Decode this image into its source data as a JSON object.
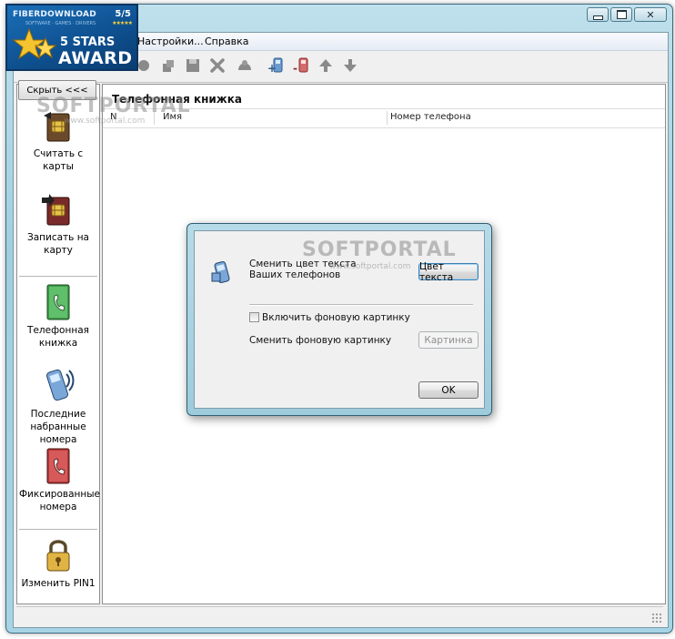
{
  "badge": {
    "brand": "FIBERDOWNLOAD",
    "tagline": "SOFTWARE · GAMES · DRIVERS",
    "score": "5/5",
    "stars_line": "5 STARS",
    "award": "AWARD",
    "color": "#1a6fb8"
  },
  "window": {
    "caption": {
      "minimize_icon": "minimize-icon",
      "maximize_icon": "maximize-icon",
      "close_glyph": "✕"
    },
    "menu": [
      "Настройки...",
      "Справка"
    ],
    "toolbar": [
      "key-icon",
      "paste-icon",
      "save-icon",
      "delete-icon",
      "contacts-icon",
      "add-phone-icon",
      "remove-phone-icon",
      "arrow-up-icon",
      "arrow-down-icon"
    ]
  },
  "sidebar": {
    "hide_button": "Скрыть <<<",
    "items": [
      {
        "label": "Считать с карты",
        "icon": "sim-read-icon"
      },
      {
        "label": "Записать на карту",
        "icon": "sim-write-icon"
      },
      {
        "label": "Телефонная книжка",
        "icon": "phonebook-icon"
      },
      {
        "label": "Последние набранные номера",
        "icon": "recent-calls-icon"
      },
      {
        "label": "Фиксированные номера",
        "icon": "fixed-numbers-icon"
      },
      {
        "label": "Изменить PIN1",
        "icon": "lock-icon"
      }
    ]
  },
  "main": {
    "title": "Телефонная книжка",
    "columns": [
      "N",
      "Имя",
      "Номер телефона"
    ]
  },
  "dialog": {
    "change_color_text": "Сменить цвет текста Ваших телефонов",
    "color_button": "Цвет текста",
    "bg_checkbox_label": "Включить фоновую картинку",
    "bg_checkbox_checked": false,
    "change_bg_text": "Сменить фоновую картинку",
    "picture_button": "Картинка",
    "ok_button": "OK"
  },
  "watermark": {
    "brand": "SOFTPORTAL",
    "url": "www.softportal.com"
  }
}
